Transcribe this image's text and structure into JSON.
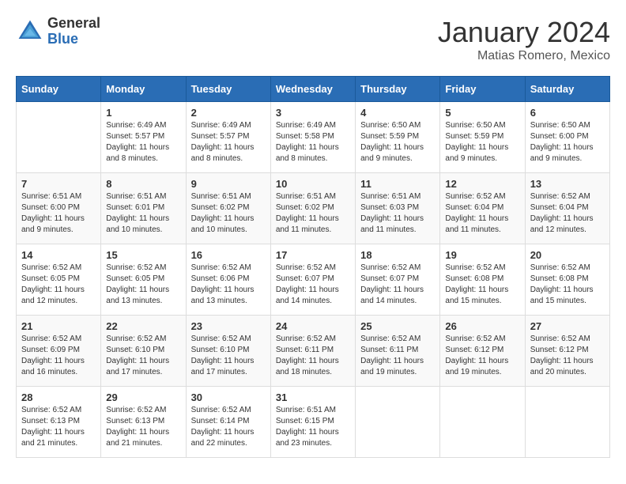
{
  "logo": {
    "general": "General",
    "blue": "Blue"
  },
  "title": "January 2024",
  "location": "Matias Romero, Mexico",
  "days_of_week": [
    "Sunday",
    "Monday",
    "Tuesday",
    "Wednesday",
    "Thursday",
    "Friday",
    "Saturday"
  ],
  "weeks": [
    [
      {
        "day": "",
        "info": ""
      },
      {
        "day": "1",
        "info": "Sunrise: 6:49 AM\nSunset: 5:57 PM\nDaylight: 11 hours\nand 8 minutes."
      },
      {
        "day": "2",
        "info": "Sunrise: 6:49 AM\nSunset: 5:57 PM\nDaylight: 11 hours\nand 8 minutes."
      },
      {
        "day": "3",
        "info": "Sunrise: 6:49 AM\nSunset: 5:58 PM\nDaylight: 11 hours\nand 8 minutes."
      },
      {
        "day": "4",
        "info": "Sunrise: 6:50 AM\nSunset: 5:59 PM\nDaylight: 11 hours\nand 9 minutes."
      },
      {
        "day": "5",
        "info": "Sunrise: 6:50 AM\nSunset: 5:59 PM\nDaylight: 11 hours\nand 9 minutes."
      },
      {
        "day": "6",
        "info": "Sunrise: 6:50 AM\nSunset: 6:00 PM\nDaylight: 11 hours\nand 9 minutes."
      }
    ],
    [
      {
        "day": "7",
        "info": "Sunrise: 6:51 AM\nSunset: 6:00 PM\nDaylight: 11 hours\nand 9 minutes."
      },
      {
        "day": "8",
        "info": "Sunrise: 6:51 AM\nSunset: 6:01 PM\nDaylight: 11 hours\nand 10 minutes."
      },
      {
        "day": "9",
        "info": "Sunrise: 6:51 AM\nSunset: 6:02 PM\nDaylight: 11 hours\nand 10 minutes."
      },
      {
        "day": "10",
        "info": "Sunrise: 6:51 AM\nSunset: 6:02 PM\nDaylight: 11 hours\nand 11 minutes."
      },
      {
        "day": "11",
        "info": "Sunrise: 6:51 AM\nSunset: 6:03 PM\nDaylight: 11 hours\nand 11 minutes."
      },
      {
        "day": "12",
        "info": "Sunrise: 6:52 AM\nSunset: 6:04 PM\nDaylight: 11 hours\nand 11 minutes."
      },
      {
        "day": "13",
        "info": "Sunrise: 6:52 AM\nSunset: 6:04 PM\nDaylight: 11 hours\nand 12 minutes."
      }
    ],
    [
      {
        "day": "14",
        "info": "Sunrise: 6:52 AM\nSunset: 6:05 PM\nDaylight: 11 hours\nand 12 minutes."
      },
      {
        "day": "15",
        "info": "Sunrise: 6:52 AM\nSunset: 6:05 PM\nDaylight: 11 hours\nand 13 minutes."
      },
      {
        "day": "16",
        "info": "Sunrise: 6:52 AM\nSunset: 6:06 PM\nDaylight: 11 hours\nand 13 minutes."
      },
      {
        "day": "17",
        "info": "Sunrise: 6:52 AM\nSunset: 6:07 PM\nDaylight: 11 hours\nand 14 minutes."
      },
      {
        "day": "18",
        "info": "Sunrise: 6:52 AM\nSunset: 6:07 PM\nDaylight: 11 hours\nand 14 minutes."
      },
      {
        "day": "19",
        "info": "Sunrise: 6:52 AM\nSunset: 6:08 PM\nDaylight: 11 hours\nand 15 minutes."
      },
      {
        "day": "20",
        "info": "Sunrise: 6:52 AM\nSunset: 6:08 PM\nDaylight: 11 hours\nand 15 minutes."
      }
    ],
    [
      {
        "day": "21",
        "info": "Sunrise: 6:52 AM\nSunset: 6:09 PM\nDaylight: 11 hours\nand 16 minutes."
      },
      {
        "day": "22",
        "info": "Sunrise: 6:52 AM\nSunset: 6:10 PM\nDaylight: 11 hours\nand 17 minutes."
      },
      {
        "day": "23",
        "info": "Sunrise: 6:52 AM\nSunset: 6:10 PM\nDaylight: 11 hours\nand 17 minutes."
      },
      {
        "day": "24",
        "info": "Sunrise: 6:52 AM\nSunset: 6:11 PM\nDaylight: 11 hours\nand 18 minutes."
      },
      {
        "day": "25",
        "info": "Sunrise: 6:52 AM\nSunset: 6:11 PM\nDaylight: 11 hours\nand 19 minutes."
      },
      {
        "day": "26",
        "info": "Sunrise: 6:52 AM\nSunset: 6:12 PM\nDaylight: 11 hours\nand 19 minutes."
      },
      {
        "day": "27",
        "info": "Sunrise: 6:52 AM\nSunset: 6:12 PM\nDaylight: 11 hours\nand 20 minutes."
      }
    ],
    [
      {
        "day": "28",
        "info": "Sunrise: 6:52 AM\nSunset: 6:13 PM\nDaylight: 11 hours\nand 21 minutes."
      },
      {
        "day": "29",
        "info": "Sunrise: 6:52 AM\nSunset: 6:13 PM\nDaylight: 11 hours\nand 21 minutes."
      },
      {
        "day": "30",
        "info": "Sunrise: 6:52 AM\nSunset: 6:14 PM\nDaylight: 11 hours\nand 22 minutes."
      },
      {
        "day": "31",
        "info": "Sunrise: 6:51 AM\nSunset: 6:15 PM\nDaylight: 11 hours\nand 23 minutes."
      },
      {
        "day": "",
        "info": ""
      },
      {
        "day": "",
        "info": ""
      },
      {
        "day": "",
        "info": ""
      }
    ]
  ]
}
